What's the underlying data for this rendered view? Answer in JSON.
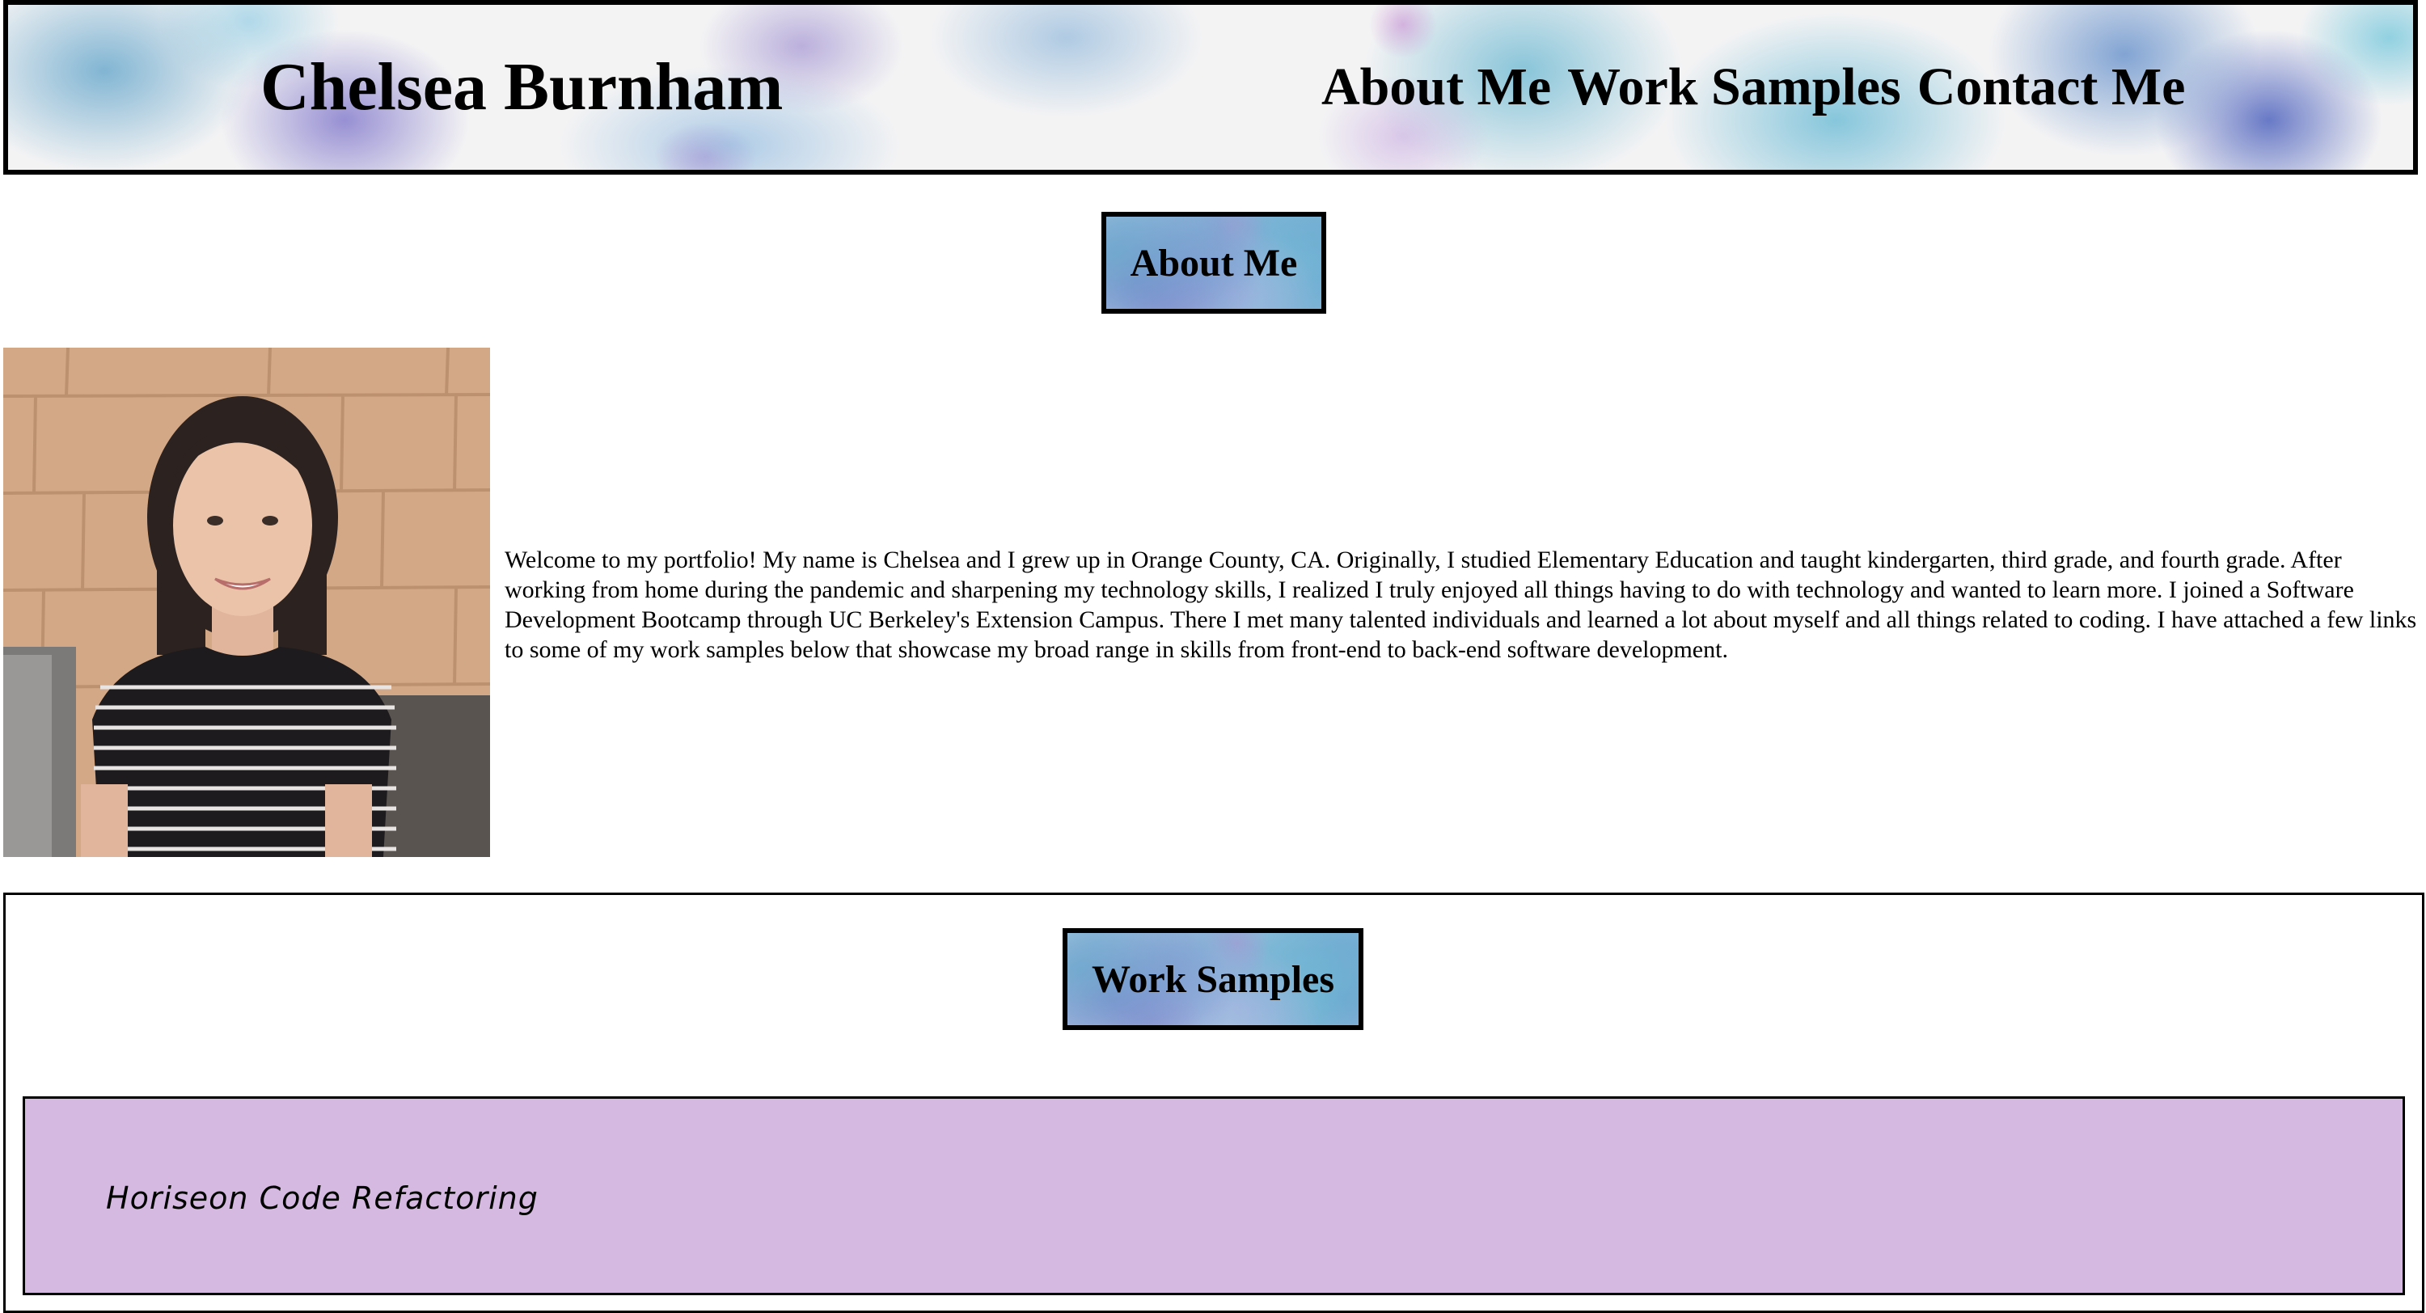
{
  "header": {
    "title": "Chelsea Burnham",
    "nav": {
      "about": "About Me",
      "work": "Work Samples",
      "contact": "Contact Me"
    }
  },
  "about": {
    "heading": "About Me",
    "photo_icon": "portrait-photo",
    "bio": "Welcome to my portfolio! My name is Chelsea and I grew up in Orange County, CA. Originally, I studied Elementary Education and taught kindergarten, third grade, and fourth grade. After working from home during the pandemic and sharpening my technology skills, I realized I truly enjoyed all things having to do with technology and wanted to learn more. I joined a Software Development Bootcamp through UC Berkeley's Extension Campus. There I met many talented individuals and learned a lot about myself and all things related to coding. I have attached a few links to some of my work samples below that showcase my broad range in skills from front-end to back-end software development."
  },
  "work": {
    "heading": "Work Samples",
    "samples": [
      {
        "title": "Horiseon Code Refactoring"
      }
    ]
  },
  "colors": {
    "card_background": "#d5b9e1",
    "border": "#000000"
  }
}
